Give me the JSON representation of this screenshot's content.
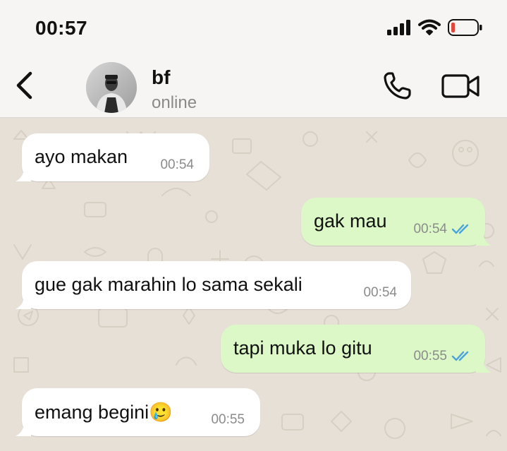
{
  "status_bar": {
    "time": "00:57",
    "icons": [
      "cellular-signal-icon",
      "wifi-icon",
      "battery-low-icon"
    ],
    "battery_color": "#e0463b"
  },
  "header": {
    "back_icon": "chevron-left-icon",
    "contact_name": "bf",
    "contact_status": "online",
    "call_icon": "phone-icon",
    "video_icon": "video-camera-icon"
  },
  "colors": {
    "incoming_bubble": "#ffffff",
    "outgoing_bubble": "#dbf8c6",
    "chat_background": "#e7e0d7",
    "read_ticks": "#4aa3df"
  },
  "messages": [
    {
      "direction": "incoming",
      "text": "ayo makan",
      "time": "00:54"
    },
    {
      "direction": "outgoing",
      "text": "gak mau",
      "time": "00:54",
      "status": "read"
    },
    {
      "direction": "incoming",
      "text": "gue gak marahin lo sama sekali",
      "time": "00:54"
    },
    {
      "direction": "outgoing",
      "text": "tapi muka lo gitu",
      "time": "00:55",
      "status": "read"
    },
    {
      "direction": "incoming",
      "text": "emang begini🥲",
      "time": "00:55"
    }
  ]
}
